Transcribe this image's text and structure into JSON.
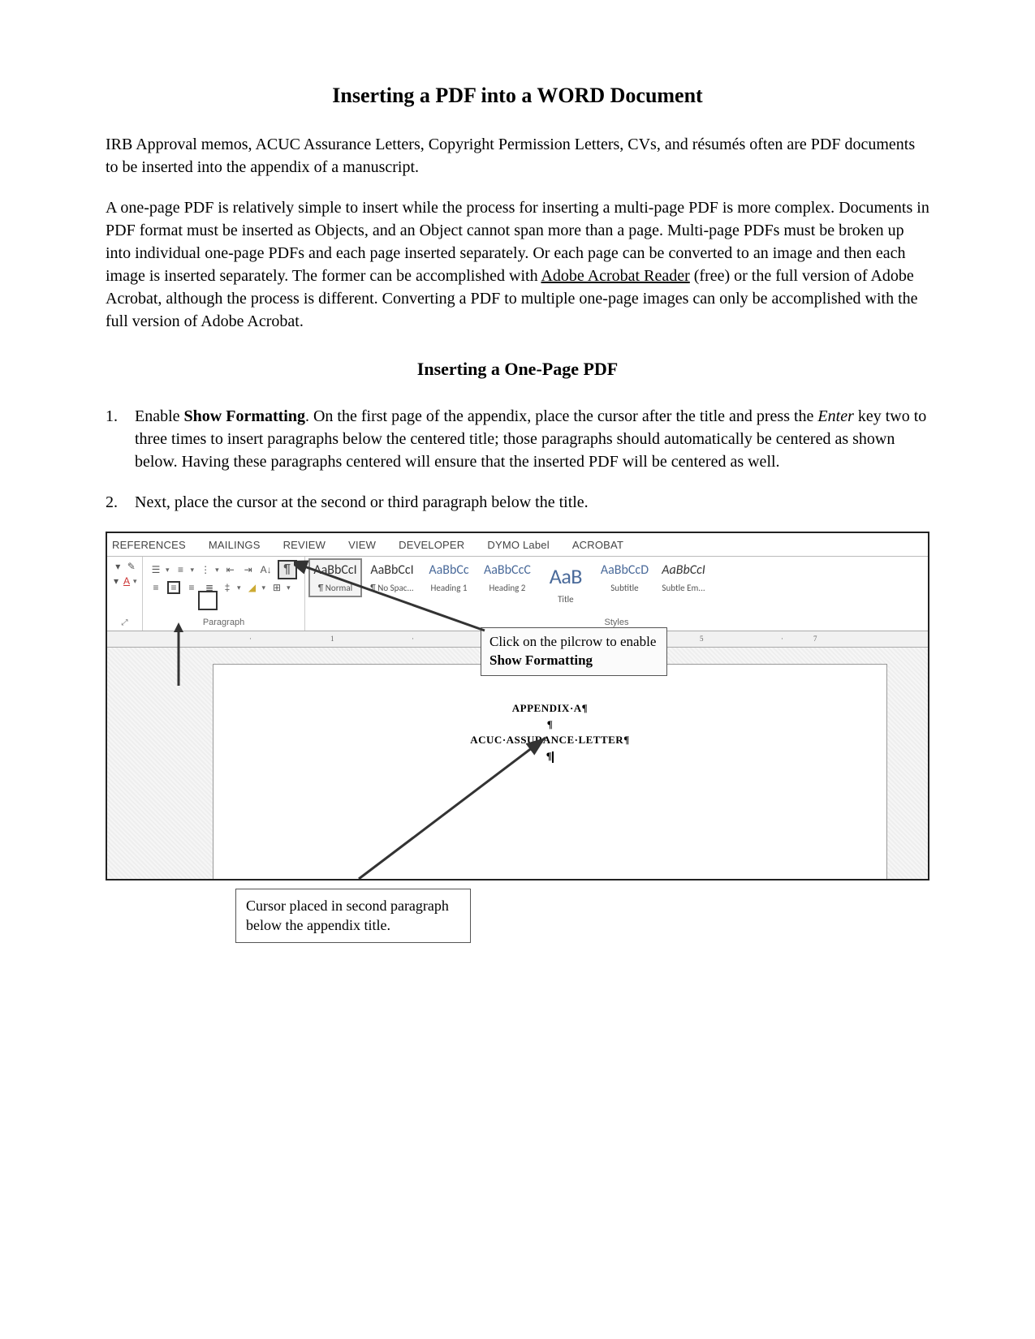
{
  "doc": {
    "title": "Inserting a PDF into a WORD Document",
    "para1": "IRB Approval memos, ACUC Assurance Letters, Copyright Permission Letters, CVs, and résumés often are PDF documents to be inserted into the appendix of a manuscript.",
    "para2a": "A one-page PDF is relatively simple to insert while the process for inserting a multi-page PDF is more complex. Documents in PDF format must be inserted as Objects, and an Object cannot span more than a page. Multi-page PDFs must be broken up into individual one-page PDFs and each page inserted separately. Or each page can be converted to an image and then each image is inserted separately. The former can be accomplished with ",
    "para2_link": "Adobe Acrobat Reader",
    "para2b": " (free) or the full version of Adobe Acrobat, although the process is different. Converting a PDF to multiple one-page images can only be accomplished with the full version of Adobe Acrobat.",
    "section_title": "Inserting a One-Page PDF",
    "step1a": "Enable ",
    "step1_bold": "Show Formatting",
    "step1b": ". On the first page of the appendix, place the cursor after the title and press the ",
    "step1_italic": "Enter",
    "step1c": " key two to three times to insert paragraphs below the centered title; those paragraphs should automatically be centered as shown below. Having these paragraphs centered will ensure that the inserted PDF will be centered as well.",
    "step2": "Next, place the cursor at the second or third paragraph below the title."
  },
  "ribbon": {
    "tabs": [
      "REFERENCES",
      "MAILINGS",
      "REVIEW",
      "VIEW",
      "DEVELOPER",
      "DYMO Label",
      "ACROBAT"
    ],
    "paragraph_label": "Paragraph",
    "styles_label": "Styles",
    "styles": [
      {
        "sample": "AaBbCcI",
        "name": "¶ Normal",
        "cls": ""
      },
      {
        "sample": "AaBbCcI",
        "name": "¶ No Spac...",
        "cls": ""
      },
      {
        "sample": "AaBbCc",
        "name": "Heading 1",
        "cls": "blue"
      },
      {
        "sample": "AaBbCcC",
        "name": "Heading 2",
        "cls": "blue"
      },
      {
        "sample": "AaB",
        "name": "Title",
        "cls": "big"
      },
      {
        "sample": "AaBbCcD",
        "name": "Subtitle",
        "cls": "blue"
      },
      {
        "sample": "AaBbCcI",
        "name": "Subtle Em...",
        "cls": "ital"
      }
    ]
  },
  "page": {
    "line1": "APPENDIX·A¶",
    "line2": "¶",
    "line3": "ACUC·ASSURANCE·LETTER¶",
    "line4": "¶"
  },
  "callouts": {
    "c1a": "Click on the pilcrow to enable ",
    "c1b": "Show Formatting",
    "c2": "Cursor placed in second paragraph below the appendix title."
  }
}
